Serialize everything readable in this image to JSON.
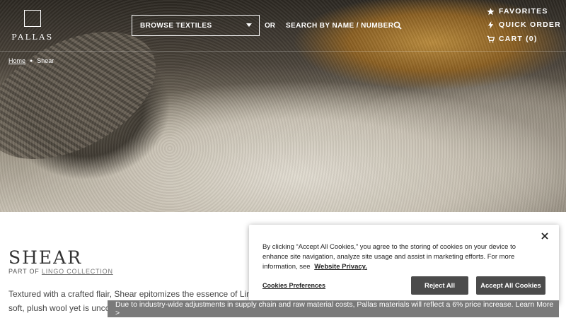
{
  "header": {
    "logo_text": "PALLAS",
    "browse_label": "BROWSE TEXTILES",
    "or_label": "OR",
    "search_label": "SEARCH BY NAME / NUMBER",
    "favorites": "FAVORITES",
    "quick_order": "QUICK ORDER",
    "cart": "CART (0)"
  },
  "breadcrumb": {
    "home": "Home",
    "current": "Shear"
  },
  "product": {
    "title": "SHEAR",
    "part_of_prefix": "PART OF",
    "collection_link": "LINGO COLLECTION",
    "description_line1": "Textured with a crafted flair, Shear epitomizes the essence of Lin",
    "description_line2": "soft, plush wool yet is uncc"
  },
  "cookie_banner": {
    "text": "By clicking “Accept All Cookies,” you agree to the storing of cookies on your device to enhance site navigation, analyze site usage and assist in marketing efforts. For more information, see",
    "privacy_link": "Website Privacy.",
    "preferences": "Cookies Preferences",
    "reject": "Reject All",
    "accept": "Accept All Cookies"
  },
  "notice_bar": {
    "text": "Due to industry-wide adjustments in supply chain and raw material costs, Pallas materials will reflect a 6% price increase. Learn More >"
  },
  "colors": {
    "button_dark": "#4b4b4b",
    "notice_bg": "#7a7a7a"
  }
}
